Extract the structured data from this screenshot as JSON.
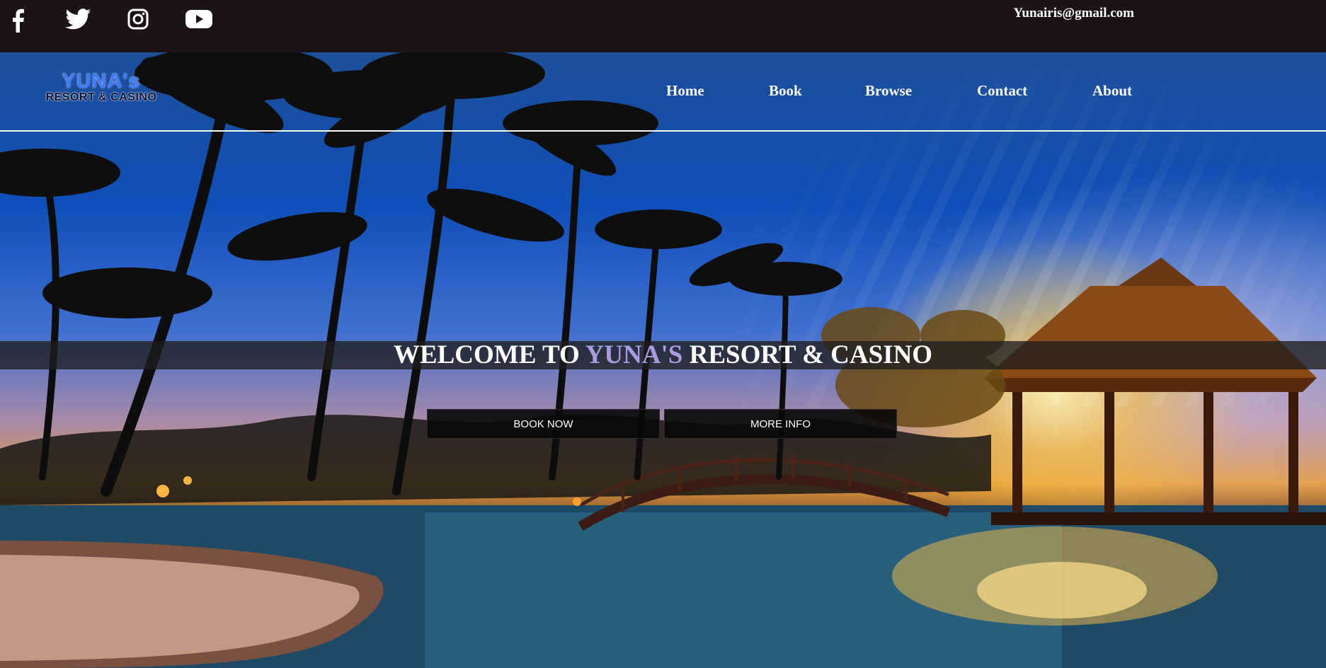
{
  "topbar": {
    "social": [
      {
        "name": "facebook-icon"
      },
      {
        "name": "twitter-icon"
      },
      {
        "name": "instagram-icon"
      },
      {
        "name": "youtube-icon"
      }
    ],
    "email": "Yunairis@gmail.com"
  },
  "logo": {
    "main": "YUNA's",
    "sub": "RESORT & CASINO"
  },
  "nav": {
    "items": [
      "Home",
      "Book",
      "Browse",
      "Contact",
      "About"
    ]
  },
  "hero": {
    "title_prefix": "WELCOME TO ",
    "title_accent": "YUNA'S",
    "title_suffix": " RESORT & CASINO",
    "accent_color": "#a99ce0",
    "book_label": "BOOK NOW",
    "info_label": "MORE INFO",
    "background": "tropical resort pool at sunset with palm trees"
  }
}
